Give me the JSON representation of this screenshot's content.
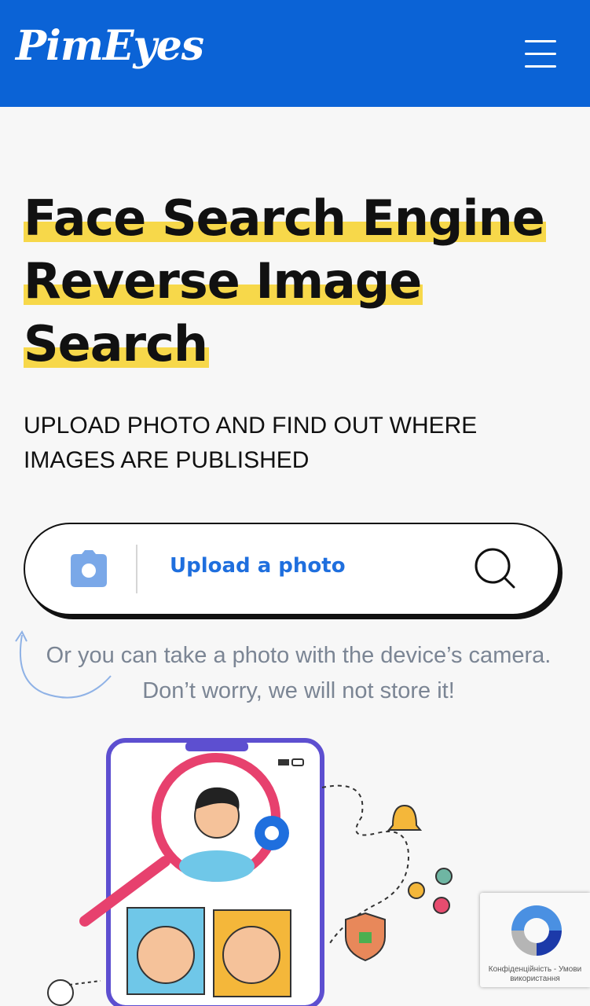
{
  "header": {
    "logo": "PimEyes",
    "menu_icon": "hamburger-menu-icon",
    "background": "#0b63d6"
  },
  "hero": {
    "title_lines": [
      "Face Search Engine",
      "Reverse Image",
      "Search"
    ],
    "highlight_color": "#f7d84a",
    "subtitle": "UPLOAD PHOTO AND FIND OUT WHERE IMAGES ARE PUBLISHED"
  },
  "upload": {
    "camera_icon": "camera-icon",
    "label": "Upload a photo",
    "search_icon": "search-icon",
    "accent": "#1f6fde"
  },
  "hint": {
    "line1": "Or you can take a photo with the device’s camera.",
    "line2": "Don’t worry, we will not store it!"
  },
  "recaptcha": {
    "text": "Конфіденційність - Умови використання"
  }
}
